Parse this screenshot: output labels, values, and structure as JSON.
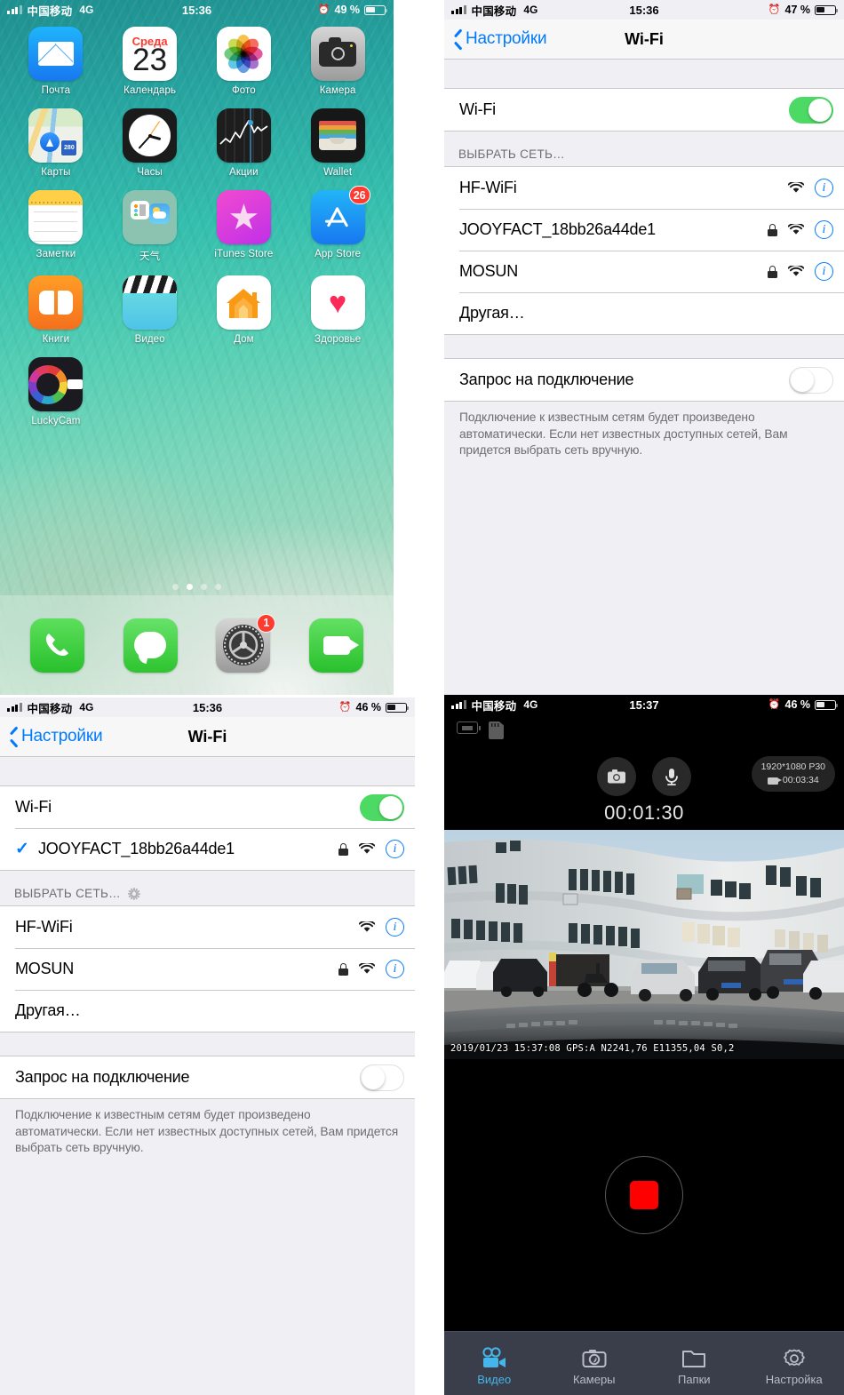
{
  "home_screen": {
    "status_bar": {
      "carrier": "中国移动",
      "network": "4G",
      "time": "15:36",
      "battery_pct": "49 %",
      "alarm_icon": "alarm-clock-icon"
    },
    "apps": [
      {
        "label": "Почта",
        "icon": "mail-icon",
        "badge": ""
      },
      {
        "label": "Календарь",
        "icon": "calendar-icon",
        "badge": "",
        "weekday": "Среда",
        "day": "23"
      },
      {
        "label": "Фото",
        "icon": "photos-icon",
        "badge": ""
      },
      {
        "label": "Камера",
        "icon": "camera-icon",
        "badge": ""
      },
      {
        "label": "Карты",
        "icon": "maps-icon",
        "badge": "",
        "shield_text": "280"
      },
      {
        "label": "Часы",
        "icon": "clock-icon",
        "badge": ""
      },
      {
        "label": "Акции",
        "icon": "stocks-icon",
        "badge": ""
      },
      {
        "label": "Wallet",
        "icon": "wallet-icon",
        "badge": ""
      },
      {
        "label": "Заметки",
        "icon": "notes-icon",
        "badge": ""
      },
      {
        "label": "天气",
        "icon": "weather-folder-icon",
        "badge": ""
      },
      {
        "label": "iTunes Store",
        "icon": "itunes-store-icon",
        "badge": ""
      },
      {
        "label": "App Store",
        "icon": "app-store-icon",
        "badge": "26"
      },
      {
        "label": "Книги",
        "icon": "books-icon",
        "badge": ""
      },
      {
        "label": "Видео",
        "icon": "videos-icon",
        "badge": ""
      },
      {
        "label": "Дом",
        "icon": "home-app-icon",
        "badge": ""
      },
      {
        "label": "Здоровье",
        "icon": "health-icon",
        "badge": ""
      },
      {
        "label": "LuckyCam",
        "icon": "luckycam-icon",
        "badge": ""
      }
    ],
    "page_dots": {
      "count": 4,
      "active_index": 1
    },
    "dock": [
      {
        "label": "Телефон",
        "icon": "phone-icon",
        "badge": ""
      },
      {
        "label": "Сообщения",
        "icon": "messages-icon",
        "badge": ""
      },
      {
        "label": "Настройки",
        "icon": "settings-gear-icon",
        "badge": "1"
      },
      {
        "label": "FaceTime",
        "icon": "facetime-icon",
        "badge": ""
      }
    ]
  },
  "wifi_panel_top": {
    "status_bar": {
      "carrier": "中国移动",
      "network": "4G",
      "time": "15:36",
      "battery_pct": "47 %",
      "alarm_icon": "alarm-clock-icon"
    },
    "nav": {
      "back_label": "Настройки",
      "title": "Wi-Fi"
    },
    "wifi_toggle": {
      "label": "Wi-Fi",
      "state": "on"
    },
    "section_header": "ВЫБРАТЬ СЕТЬ…",
    "section_header_spinner": false,
    "networks": [
      {
        "ssid": "HF-WiFi",
        "locked": false,
        "connected": false,
        "signal": "wifi-icon",
        "info": "info-icon"
      },
      {
        "ssid": "JOOYFACT_18bb26a44de1",
        "locked": true,
        "connected": false,
        "signal": "wifi-icon",
        "info": "info-icon"
      },
      {
        "ssid": "MOSUN",
        "locked": true,
        "connected": false,
        "signal": "wifi-icon",
        "info": "info-icon"
      }
    ],
    "other_network": "Другая…",
    "ask_to_join": {
      "label": "Запрос на подключение",
      "state": "off"
    },
    "footnote": "Подключение к известным сетям будет произведено автоматически. Если нет известных доступных сетей, Вам придется выбрать сеть вручную."
  },
  "wifi_panel_bottom": {
    "status_bar": {
      "carrier": "中国移动",
      "network": "4G",
      "time": "15:36",
      "battery_pct": "46 %",
      "alarm_icon": "alarm-clock-icon"
    },
    "nav": {
      "back_label": "Настройки",
      "title": "Wi-Fi"
    },
    "wifi_toggle": {
      "label": "Wi-Fi",
      "state": "on"
    },
    "connected_network": {
      "ssid": "JOOYFACT_18bb26a44de1",
      "locked": true,
      "connected": true,
      "check": "✓"
    },
    "section_header": "ВЫБРАТЬ СЕТЬ…",
    "section_header_spinner": true,
    "networks": [
      {
        "ssid": "HF-WiFi",
        "locked": false,
        "connected": false,
        "signal": "wifi-icon",
        "info": "info-icon"
      },
      {
        "ssid": "MOSUN",
        "locked": true,
        "connected": false,
        "signal": "wifi-icon",
        "info": "info-icon"
      }
    ],
    "other_network": "Другая…",
    "ask_to_join": {
      "label": "Запрос на подключение",
      "state": "off"
    },
    "footnote": "Подключение к известным сетям будет произведено автоматически. Если нет известных доступных сетей, Вам придется выбрать сеть вручную."
  },
  "dashcam_app": {
    "status_bar": {
      "carrier": "中国移动",
      "network": "4G",
      "time": "15:37",
      "battery_pct": "46 %",
      "alarm_icon": "alarm-clock-icon"
    },
    "device_icons": [
      "battery-icon",
      "sd-card-icon"
    ],
    "action_buttons": [
      {
        "name": "snapshot-button",
        "icon": "camera-icon"
      },
      {
        "name": "microphone-button",
        "icon": "microphone-icon"
      }
    ],
    "resolution_pill": {
      "resolution": "1920*1080 P30",
      "clip_length": "00:03:34",
      "icon": "video-camera-icon"
    },
    "elapsed_timer": "00:01:30",
    "video_osd": "2019/01/23 15:37:08 GPS:A N2241,76 E11355,04 S0,2",
    "record_button": {
      "name": "stop-recording-button",
      "state": "recording",
      "color": "#ff0000"
    },
    "tabs": [
      {
        "label": "Видео",
        "icon": "video-camera-icon",
        "active": true
      },
      {
        "label": "Камеры",
        "icon": "camera-icon",
        "active": false
      },
      {
        "label": "Папки",
        "icon": "folder-icon",
        "active": false
      },
      {
        "label": "Настройка",
        "icon": "gear-icon",
        "active": false
      }
    ]
  },
  "colors": {
    "ios_blue": "#007aff",
    "ios_green": "#4cd964",
    "badge_red": "#ff3b30",
    "record_red": "#ff0000",
    "tab_active_blue": "#45b6ea",
    "tab_bar_bg": "#3a3d4a"
  }
}
